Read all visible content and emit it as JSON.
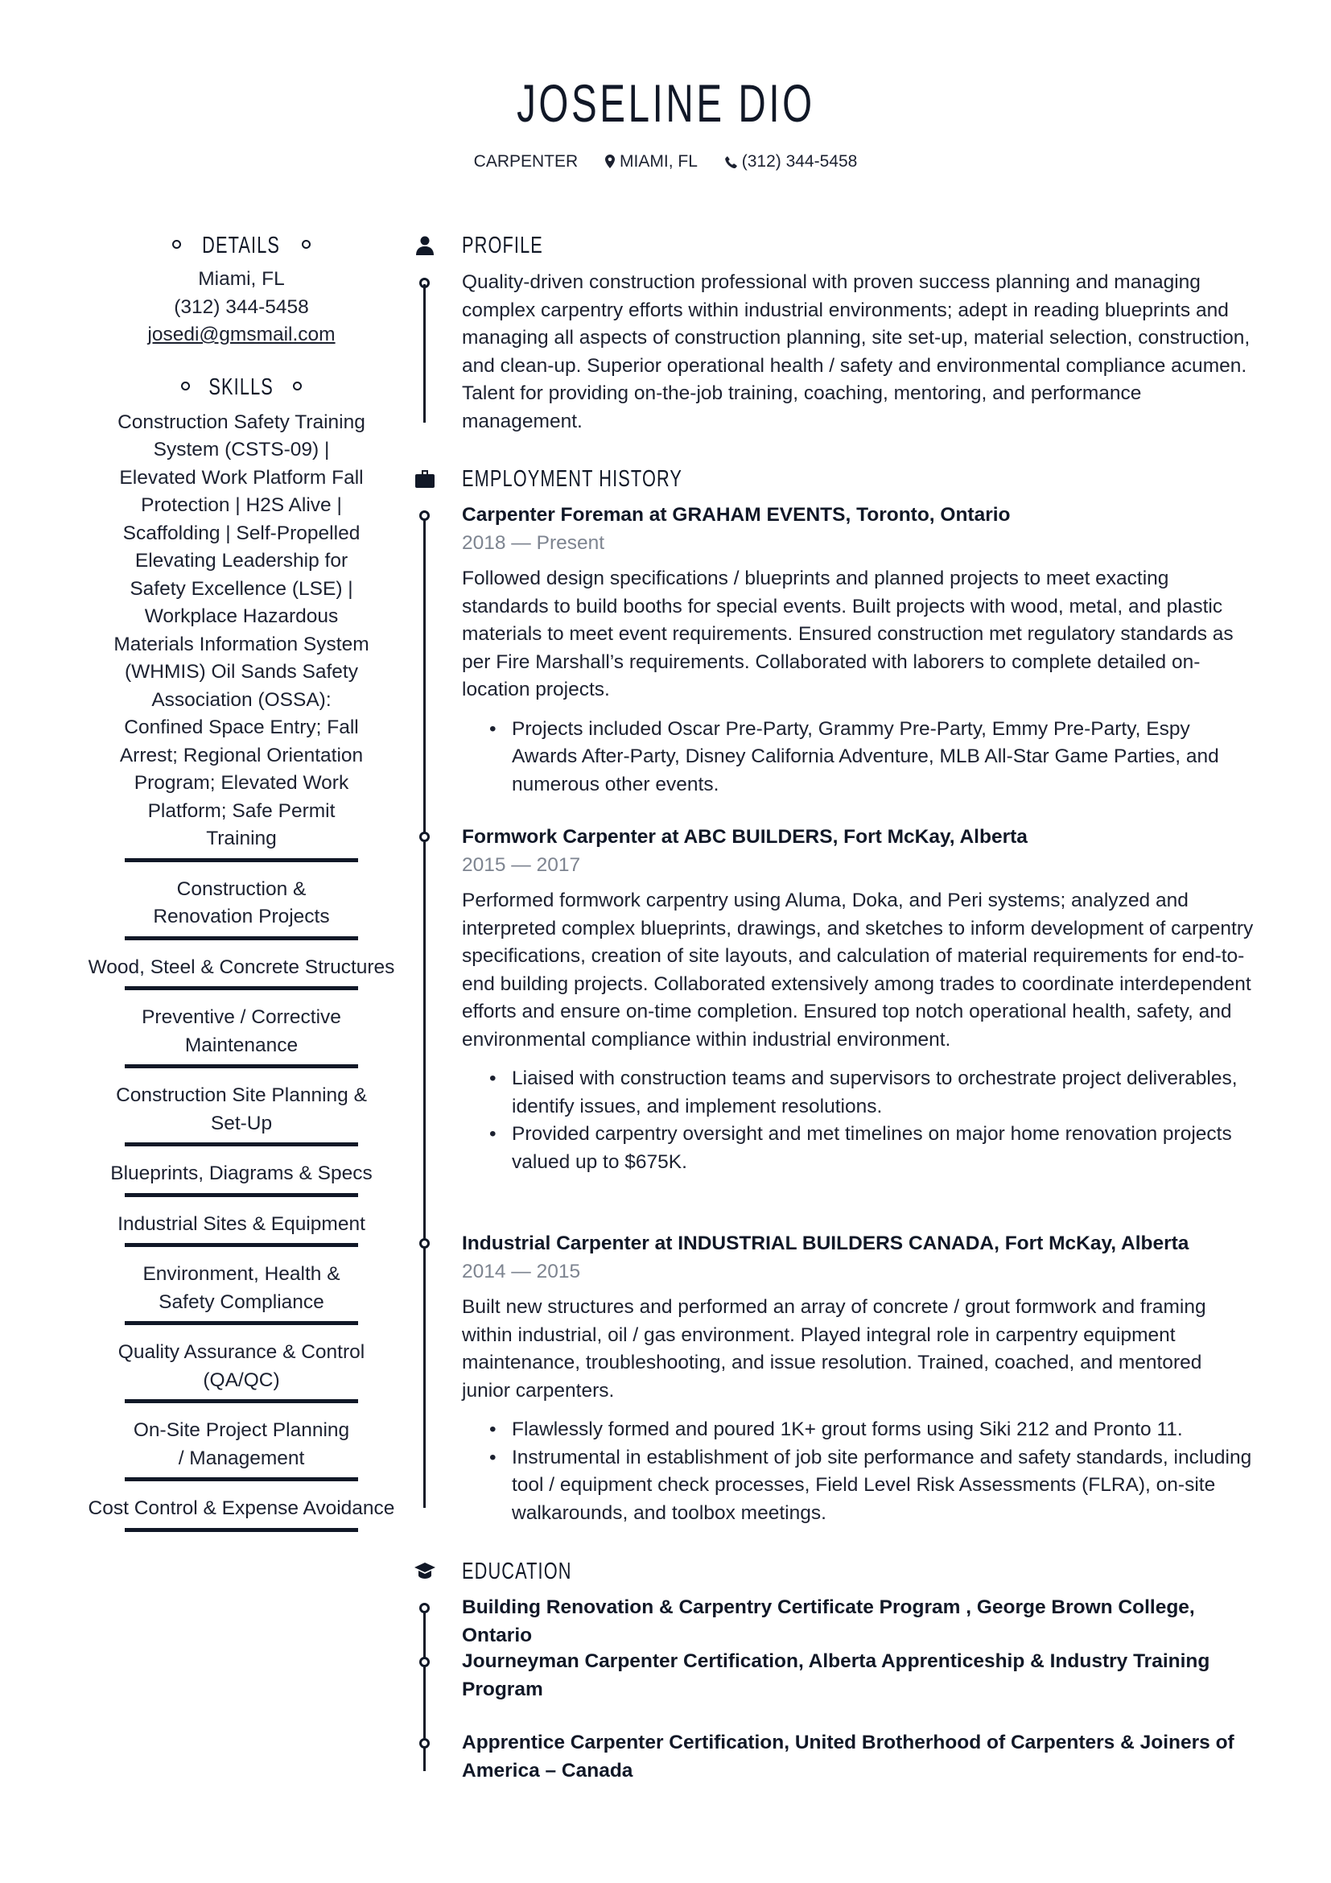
{
  "header": {
    "name": "JOSELINE DIO",
    "job_title": "CARPENTER",
    "location": "MIAMI, FL",
    "phone": "(312) 344-5458",
    "location_icon": "map-pin-icon",
    "phone_icon": "phone-icon"
  },
  "sidebar": {
    "details": {
      "heading": "DETAILS",
      "city": "Miami, FL",
      "phone": "(312) 344-5458",
      "email": "josedi@gmsmail.com"
    },
    "skills": {
      "heading": "SKILLS",
      "intro": "Construction Safety Training System (CSTS-09) | Elevated Work Platform Fall Protection | H2S Alive | Scaffolding | Self-Propelled Elevating Leadership for Safety Excellence (LSE) | Workplace Hazardous Materials Information System (WHMIS) Oil Sands Safety Association (OSSA): Confined Space Entry; Fall Arrest; Regional Orientation Program; Elevated Work Platform; Safe Permit Training",
      "intro_level": 1.0,
      "items": [
        {
          "name": "Construction & Renovation Projects",
          "level": 1.0
        },
        {
          "name": "Wood, Steel & Concrete Structures",
          "level": 1.0
        },
        {
          "name": "Preventive / Corrective Maintenance",
          "level": 1.0
        },
        {
          "name": "Construction Site Planning & Set-Up",
          "level": 1.0
        },
        {
          "name": "Blueprints, Diagrams & Specs",
          "level": 1.0
        },
        {
          "name": "Industrial Sites & Equipment",
          "level": 1.0
        },
        {
          "name": "Environment, Health & Safety Compliance",
          "level": 1.0
        },
        {
          "name": "Quality Assurance & Control (QA/QC)",
          "level": 1.0
        },
        {
          "name": "On-Site Project Planning / Management",
          "level": 1.0
        },
        {
          "name": "Cost Control & Expense Avoidance",
          "level": 1.0
        }
      ]
    }
  },
  "profile": {
    "heading": "PROFILE",
    "icon": "person-icon",
    "text": "Quality-driven construction professional with proven success planning and managing complex carpentry efforts within industrial environments; adept in reading blueprints and managing all aspects of construction planning, site set-up, material selection, construction, and clean-up. Superior operational health / safety and environmental compliance acumen. Talent for providing on-the-job training, coaching, mentoring, and performance management."
  },
  "employment": {
    "heading": "EMPLOYMENT HISTORY",
    "icon": "briefcase-icon",
    "jobs": [
      {
        "title": "Carpenter Foreman at GRAHAM EVENTS, Toronto, Ontario",
        "dates": "2018 — Present",
        "description": "Followed design specifications / blueprints and planned projects to meet exacting standards to build booths for special events. Built projects with wood, metal, and plastic materials to meet event requirements. Ensured construction met regulatory standards as per Fire Marshall’s requirements. Collaborated with laborers to complete detailed on-location projects.",
        "bullets": [
          "Projects included Oscar Pre-Party, Grammy Pre-Party, Emmy Pre-Party, Espy Awards After-Party, Disney California Adventure, MLB All-Star Game Parties, and numerous other events."
        ]
      },
      {
        "title": "Formwork Carpenter at ABC BUILDERS, Fort McKay, Alberta",
        "dates": "2015 — 2017",
        "description": "Performed formwork carpentry using Aluma, Doka, and Peri systems; analyzed and interpreted complex blueprints, drawings, and sketches to inform development of carpentry specifications, creation of site layouts, and calculation of material requirements for end-to-end building projects. Collaborated extensively among trades to coordinate interdependent efforts and ensure on-time completion. Ensured top notch operational health, safety, and environmental compliance within industrial environment.",
        "bullets": [
          "Liaised with construction teams and supervisors to orchestrate project deliverables, identify issues, and implement resolutions.",
          "Provided carpentry oversight and met timelines on major home renovation projects valued up to $675K."
        ]
      },
      {
        "title": "Industrial Carpenter at INDUSTRIAL BUILDERS CANADA, Fort McKay, Alberta",
        "dates": "2014 — 2015",
        "description": "Built new structures and performed an array of concrete / grout formwork and framing within industrial, oil / gas environment. Played integral role in carpentry equipment maintenance, troubleshooting, and issue resolution. Trained, coached, and mentored junior carpenters.",
        "bullets": [
          "Flawlessly formed and poured 1K+ grout forms using Siki 212 and Pronto 11.",
          "Instrumental in establishment of job site performance and safety standards, including tool / equipment check processes, Field Level Risk Assessments (FLRA), on-site walkarounds, and toolbox meetings."
        ]
      }
    ]
  },
  "education": {
    "heading": "EDUCATION",
    "icon": "graduation-cap-icon",
    "items": [
      "Building Renovation & Carpentry Certificate Program , George Brown College, Ontario",
      "Journeyman Carpenter Certification, Alberta Apprenticeship & Industry Training Program",
      "Apprentice Carpenter Certification, United Brotherhood of Carpenters & Joiners of America – Canada"
    ]
  },
  "colors": {
    "text": "#1c2130",
    "heading": "#111827",
    "muted": "#7d8490",
    "accent": "#111827"
  }
}
